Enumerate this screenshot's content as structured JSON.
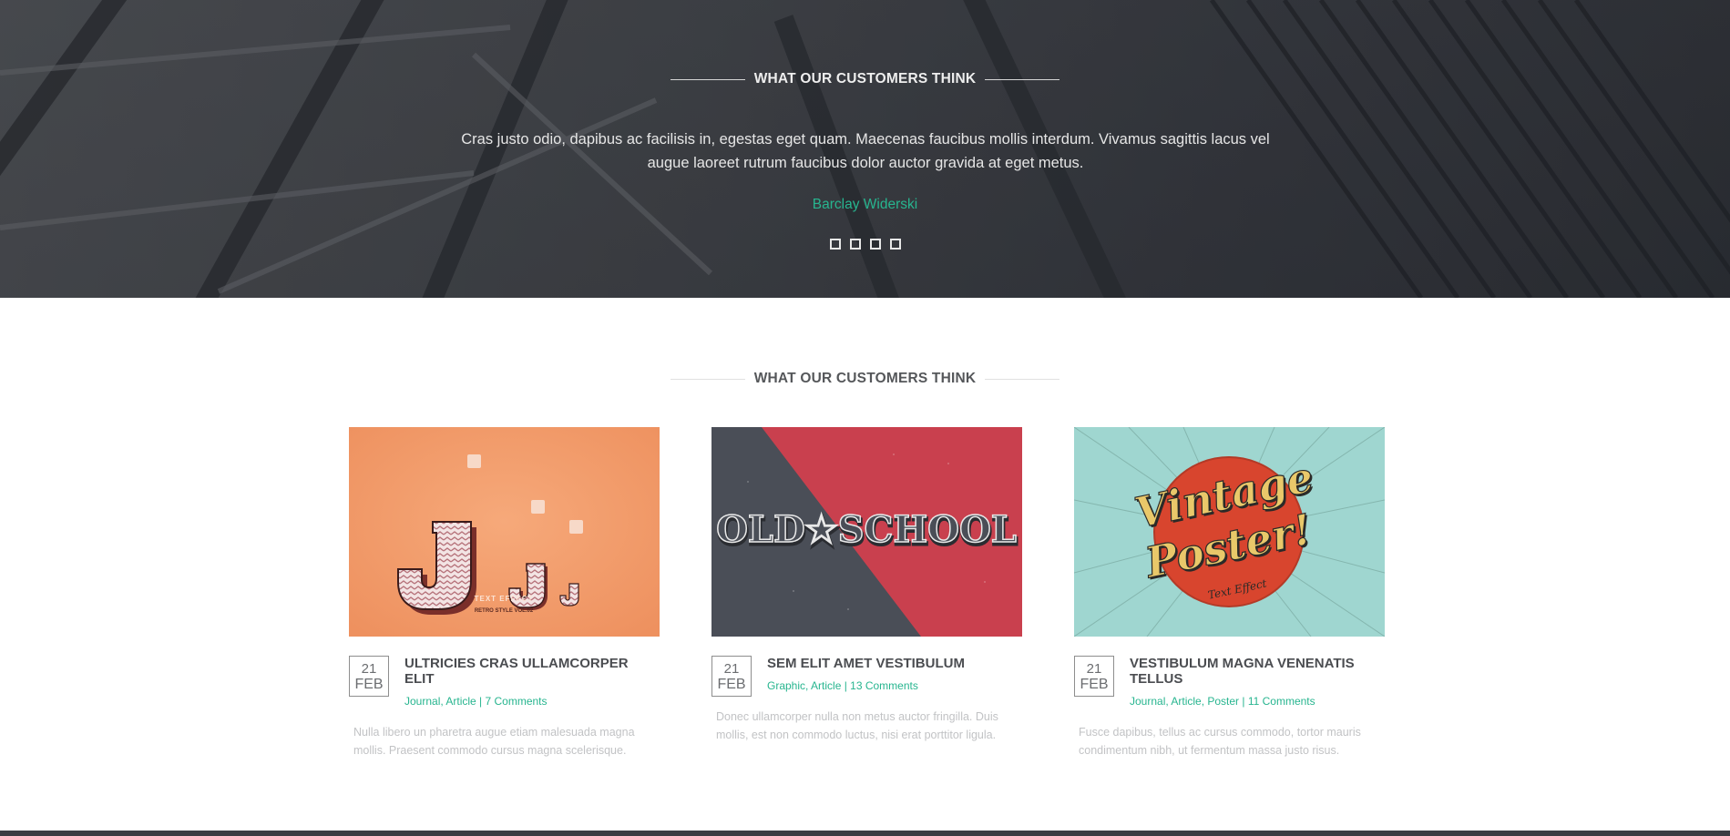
{
  "testimonial": {
    "heading": "WHAT OUR CUSTOMERS THINK",
    "quote": "Cras justo odio, dapibus ac facilisis in, egestas eget quam. Maecenas faucibus mollis interdum. Vivamus sagittis lacus vel augue laoreet rutrum faucibus dolor auctor gravida at eget metus.",
    "author": "Barclay Widerski",
    "slides": 4
  },
  "posts": {
    "heading": "WHAT OUR CUSTOMERS THINK",
    "items": [
      {
        "day": "21",
        "month": "FEB",
        "title": "ULTRICIES CRAS ULLAMCORPER ELIT",
        "tags": "Journal, Article | 7 Comments",
        "excerpt": "Nulla libero un pharetra augue etiam malesuada magna mollis. Praesent commodo cursus magna scelerisque.",
        "image": {
          "caption": "TEXT EFFECT",
          "subcaption": "RETRO STYLE VOL.02"
        }
      },
      {
        "day": "21",
        "month": "FEB",
        "title": "SEM ELIT AMET VESTIBULUM",
        "tags": "Graphic, Article | 13 Comments",
        "excerpt": "Donec ullamcorper nulla non metus auctor fringilla. Duis mollis, est non commodo luctus, nisi erat porttitor ligula.",
        "image": {
          "caption": "OLD★SCHOOL"
        }
      },
      {
        "day": "21",
        "month": "FEB",
        "title": "VESTIBULUM MAGNA VENENATIS TELLUS",
        "tags": "Journal, Article, Poster | 11 Comments",
        "excerpt": "Fusce dapibus, tellus ac cursus commodo, tortor mauris condimentum nibh, ut fermentum massa justo risus.",
        "image": {
          "caption_line1": "Vintage",
          "caption_line2": "Poster!",
          "subcaption": "Text Effect"
        }
      }
    ]
  },
  "colors": {
    "accent": "#27b58f",
    "dark": "#3a3d43"
  }
}
